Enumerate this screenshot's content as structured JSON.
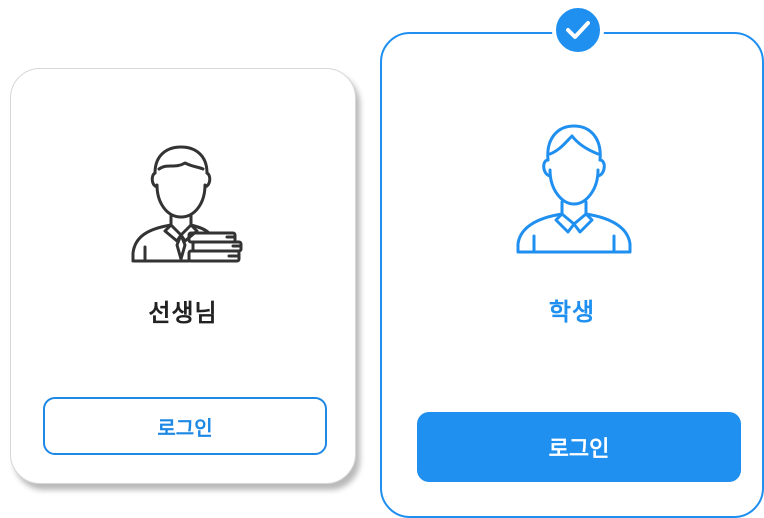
{
  "cards": {
    "teacher": {
      "title": "선생님",
      "login_label": "로그인",
      "icon": "teacher-with-books-icon",
      "selected": false
    },
    "student": {
      "title": "학생",
      "login_label": "로그인",
      "icon": "student-icon",
      "selected": true
    }
  },
  "colors": {
    "accent": "#1f8ff0",
    "text_dark": "#222222",
    "icon_dark": "#333333",
    "card_border": "#d7d7d7"
  },
  "selected_badge_icon": "checkmark-icon"
}
